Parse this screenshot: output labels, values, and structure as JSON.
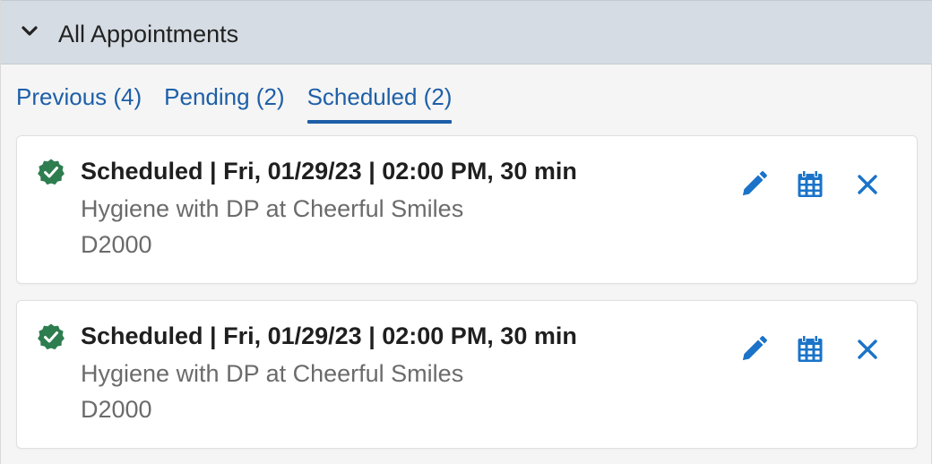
{
  "header": {
    "title": "All Appointments",
    "chevron_icon": "chevron-down-icon"
  },
  "tabs": [
    {
      "label": "Previous (4)",
      "active": false
    },
    {
      "label": "Pending (2)",
      "active": false
    },
    {
      "label": "Scheduled (2)",
      "active": true
    }
  ],
  "appointments": [
    {
      "status_icon": "check-badge-icon",
      "title": "Scheduled | Fri, 01/29/23 | 02:00 PM, 30 min",
      "subtitle": "Hygiene with DP at Cheerful Smiles",
      "code": "D2000",
      "actions": [
        "pencil-icon",
        "calendar-icon",
        "close-icon"
      ]
    },
    {
      "status_icon": "check-badge-icon",
      "title": "Scheduled | Fri, 01/29/23 | 02:00 PM, 30 min",
      "subtitle": "Hygiene with DP at Cheerful Smiles",
      "code": "D2000",
      "actions": [
        "pencil-icon",
        "calendar-icon",
        "close-icon"
      ]
    }
  ],
  "colors": {
    "header_bg": "#d5dce3",
    "link": "#1d5fa8",
    "success": "#2e7d4f",
    "action_icon": "#1a73c8",
    "muted_text": "#6b6b6b"
  }
}
